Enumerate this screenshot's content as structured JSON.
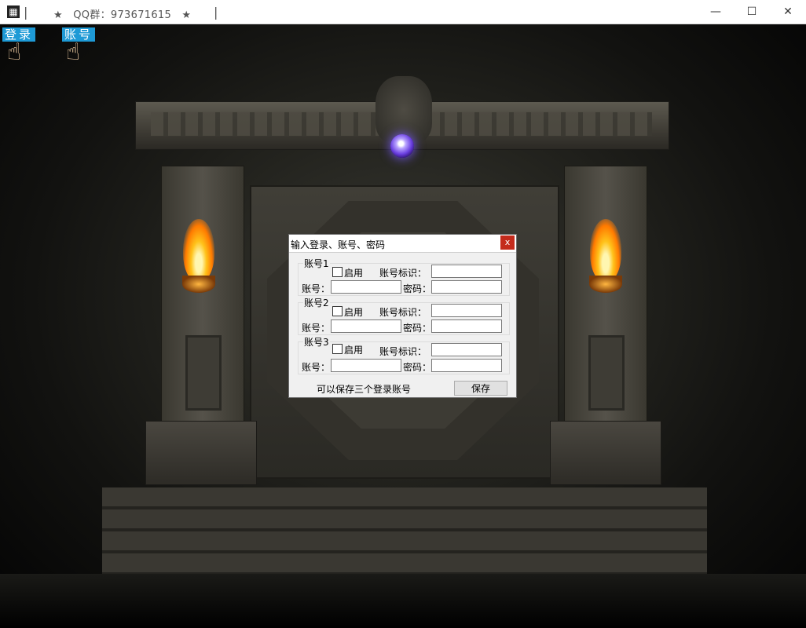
{
  "window": {
    "title": "★   QQ群：973671615   ★",
    "icon": "app-icon",
    "separator": "|",
    "controls": [
      "minimize-icon",
      "maximize-icon",
      "close-icon"
    ],
    "control_glyphs": {
      "minimize": "—",
      "maximize": "☐",
      "close": "✕"
    }
  },
  "toolbar": {
    "login_label": "登录",
    "account_label": "账号",
    "hand_icon": "☝"
  },
  "dialog": {
    "title": "输入登录、账号、密码",
    "close_label": "x",
    "accounts": [
      {
        "group": "账号1",
        "enable": "启用",
        "tag": "账号标识：",
        "account": "账号：",
        "password": "密码：",
        "tag_value": "",
        "account_value": "",
        "password_value": ""
      },
      {
        "group": "账号2",
        "enable": "启用",
        "tag": "账号标识：",
        "account": "账号：",
        "password": "密码：",
        "tag_value": "",
        "account_value": "",
        "password_value": ""
      },
      {
        "group": "账号3",
        "enable": "启用",
        "tag": "账号标识：",
        "account": "账号：",
        "password": "密码：",
        "tag_value": "",
        "account_value": "",
        "password_value": ""
      }
    ],
    "hint": "可以保存三个登录账号",
    "save_label": "保存"
  },
  "colors": {
    "button_blue": "#1e9ad6",
    "close_red": "#c42b1c"
  }
}
